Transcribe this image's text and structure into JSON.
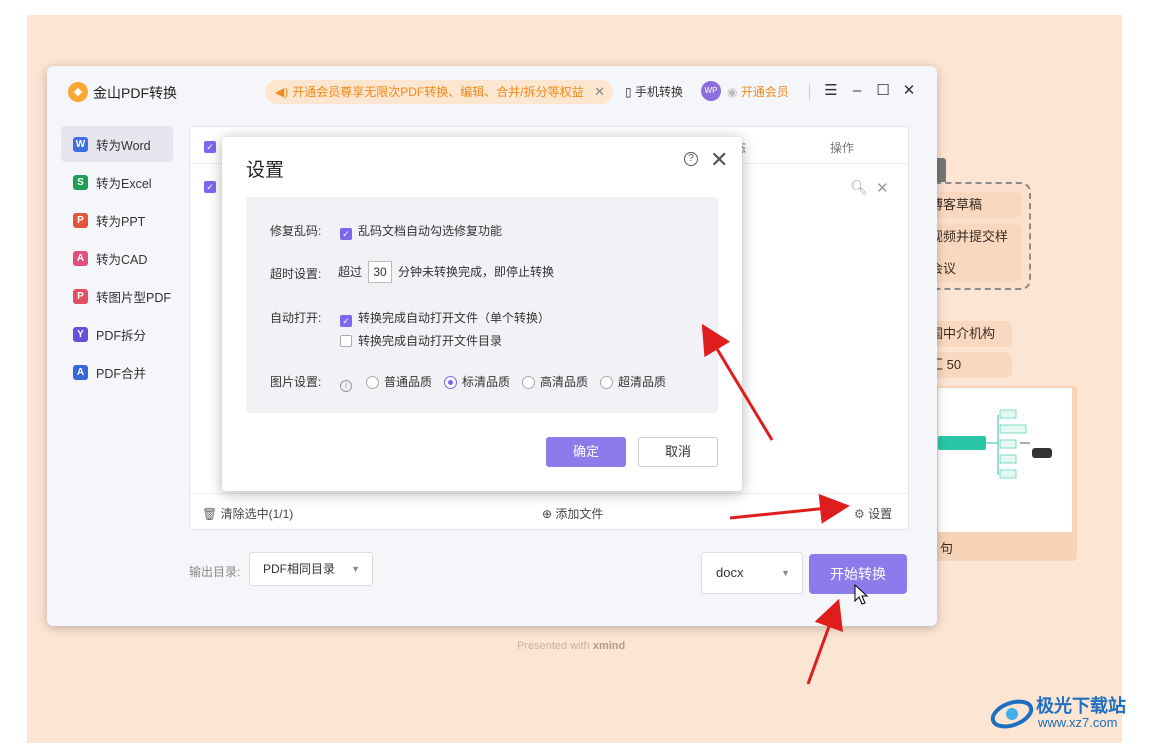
{
  "background": {
    "cards": [
      "博客草稿",
      "视频并提交样片",
      "会议",
      "国中介机构",
      "汇 50",
      "句"
    ],
    "presented_by": "Presented with",
    "presented_brand": "xmind"
  },
  "titlebar": {
    "app_title": "金山PDF转换",
    "promo_text": "开通会员尊享无限次PDF转换、编辑、合并/拆分等权益",
    "phone_convert": "手机转换",
    "avatar_text": "WP",
    "vip_label": "开通会员"
  },
  "sidebar": {
    "items": [
      {
        "label": "转为Word",
        "icon": "W",
        "color": "#3f6fe0"
      },
      {
        "label": "转为Excel",
        "icon": "S",
        "color": "#1f9e5a"
      },
      {
        "label": "转为PPT",
        "icon": "P",
        "color": "#e2553b"
      },
      {
        "label": "转为CAD",
        "icon": "A",
        "color": "#e04f7a"
      },
      {
        "label": "转图片型PDF",
        "icon": "P",
        "color": "#e04f5f"
      },
      {
        "label": "PDF拆分",
        "icon": "Y",
        "color": "#6a4fd8"
      },
      {
        "label": "PDF合并",
        "icon": "A",
        "color": "#3a66d8"
      }
    ]
  },
  "panel": {
    "col_status_fragment": "态",
    "col_action": "操作",
    "clear_selected": "清除选中(1/1)",
    "add_file": "添加文件",
    "settings": "设置"
  },
  "footer": {
    "output_label": "输出目录:",
    "output_value": "PDF相同目录",
    "format_value": "docx",
    "start_button": "开始转换"
  },
  "dialog": {
    "title": "设置",
    "repair_label": "修复乱码:",
    "repair_option": "乱码文档自动勾选修复功能",
    "timeout_label": "超时设置:",
    "timeout_prefix": "超过",
    "timeout_value": "30",
    "timeout_suffix": "分钟未转换完成，即停止转换",
    "auto_open_label": "自动打开:",
    "auto_open_file": "转换完成自动打开文件（单个转换）",
    "auto_open_dir": "转换完成自动打开文件目录",
    "image_label": "图片设置:",
    "quality_options": [
      "普通品质",
      "标清品质",
      "高清品质",
      "超清品质"
    ],
    "quality_selected": "标清品质",
    "ok": "确定",
    "cancel": "取消"
  },
  "watermark": {
    "name": "极光下载站",
    "url": "www.xz7.com"
  },
  "colors": {
    "accent": "#8c7bea",
    "promo_text": "#f08a1c",
    "arrow": "#e01d1d"
  }
}
